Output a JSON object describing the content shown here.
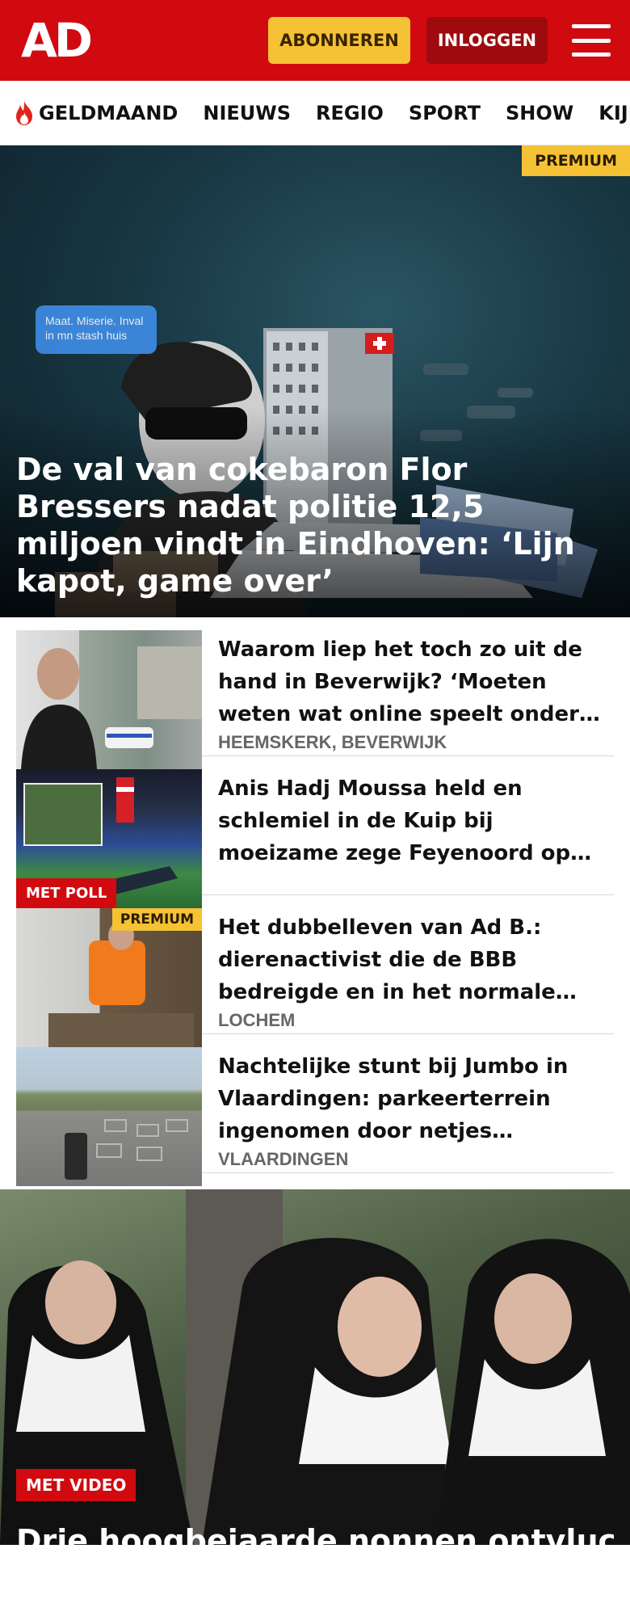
{
  "header": {
    "logo": "AD",
    "subscribe_label": "ABONNEREN",
    "login_label": "INLOGGEN",
    "menu_icon": "hamburger-menu-icon",
    "brand_color": "#d10a10",
    "accent_color": "#f5c235"
  },
  "nav": {
    "items": [
      {
        "label": "GELDMAAND",
        "icon": "flame-icon"
      },
      {
        "label": "NIEUWS"
      },
      {
        "label": "REGIO"
      },
      {
        "label": "SPORT"
      },
      {
        "label": "SHOW"
      },
      {
        "label": "KIJK"
      }
    ]
  },
  "hero": {
    "badge": "PREMIUM",
    "title": "De val van cokebaron Flor Bressers nadat politie 12,5 miljoen vindt in Eindhoven: ‘Lijn kapot, game over’",
    "bubble_text": "Maat. Miserie. Inval in mn stash huis"
  },
  "articles": [
    {
      "title": "Waarom liep het toch zo uit de hand in Beverwijk? ‘Moeten weten wat online speelt onder jongeren’",
      "location": "HEEMSKERK, BEVERWIJK",
      "tag": ""
    },
    {
      "title": "Anis Hadj Moussa held en schlemiel in de Kuip bij moeizame zege Feyenoord op Sparta",
      "location": "",
      "tag": "MET POLL"
    },
    {
      "title": "Het dubbelleven van Ad B.: dierenactivist die de BBB bedreigde en in het normale leven",
      "location": "LOCHEM",
      "tag": "PREMIUM"
    },
    {
      "title": "Nachtelijke stunt bij Jumbo in Vlaardingen: parkeerterrein ingenomen door netjes geparkeerde winkelwagens",
      "location": "VLAARDINGEN",
      "tag": ""
    }
  ],
  "hero2": {
    "tag": "MET VIDEO",
    "title": "Drie hoogbejaarde nonnen ontvluch-"
  }
}
